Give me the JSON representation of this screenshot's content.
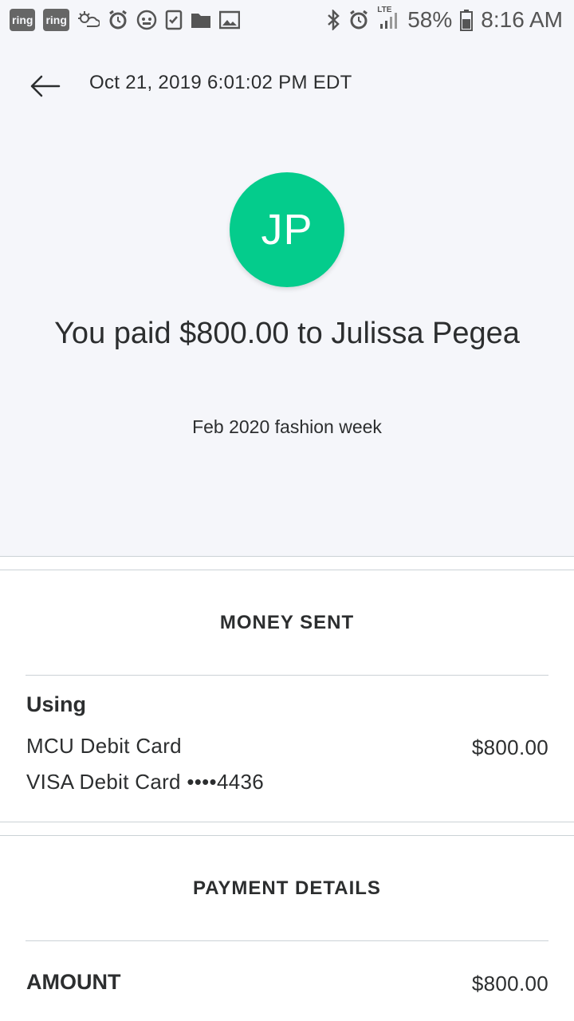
{
  "status_bar": {
    "left_icons": [
      "ring-icon",
      "ring-icon",
      "weather-icon",
      "alarm-icon",
      "gamepad-icon",
      "checklist-icon",
      "folder-icon",
      "image-icon"
    ],
    "ring_label": "ring",
    "network_label": "LTE",
    "battery": "58%",
    "time": "8:16 AM"
  },
  "header": {
    "timestamp": "Oct 21, 2019 6:01:02 PM EDT"
  },
  "recipient": {
    "initials": "JP",
    "avatar_color": "#04cc8c",
    "headline": "You paid $800.00 to Julissa Pegea",
    "note": "Feb 2020 fashion week"
  },
  "money_sent": {
    "title": "MONEY SENT",
    "using_label": "Using",
    "source_name": "MCU Debit Card",
    "source_detail": "VISA Debit Card ••••4436",
    "amount": "$800.00"
  },
  "payment_details": {
    "title": "PAYMENT DETAILS",
    "amount_label": "AMOUNT",
    "amount_value": "$800.00"
  }
}
